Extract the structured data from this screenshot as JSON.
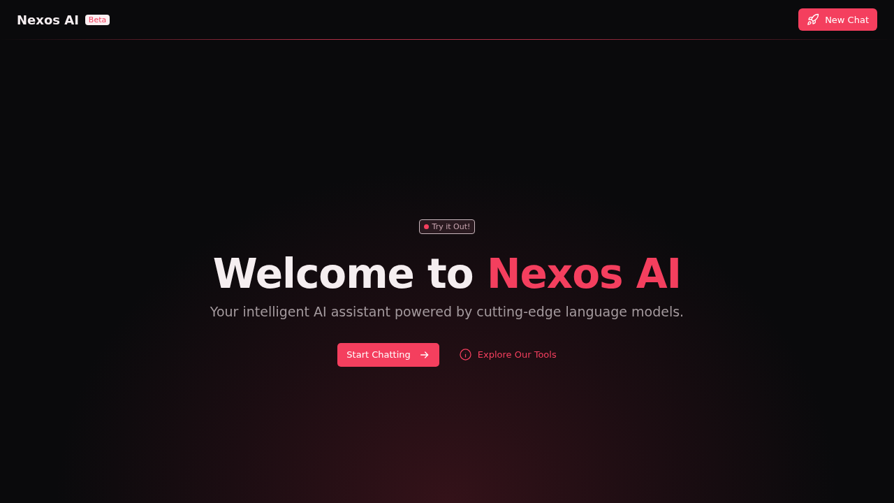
{
  "header": {
    "brand": "Nexos AI",
    "badge": "Beta",
    "new_chat_button": "New Chat"
  },
  "hero": {
    "pill": "Try it Out!",
    "title_lead": "Welcome to",
    "title_accent": "Nexos AI",
    "subtitle": "Your intelligent AI assistant powered by cutting-edge language models.",
    "primary_button": "Start Chatting",
    "secondary_link": "Explore Our Tools"
  }
}
